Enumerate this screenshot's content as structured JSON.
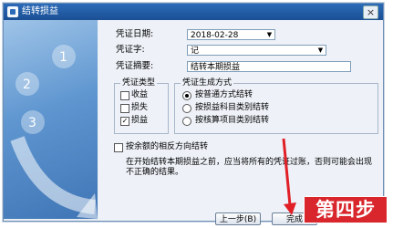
{
  "window": {
    "title": "结转损益",
    "close_glyph": "×"
  },
  "form": {
    "date_label": "凭证日期:",
    "date_value": "2018-02-28",
    "type_label": "凭证字:",
    "type_value": "记",
    "summary_label": "凭证摘要:",
    "summary_value": "结转本期损益"
  },
  "voucher_type_group": {
    "title": "凭证类型",
    "items": [
      {
        "label": "收益",
        "checked": false
      },
      {
        "label": "损失",
        "checked": false
      },
      {
        "label": "损益",
        "checked": true
      }
    ]
  },
  "generation_group": {
    "title": "凭证生成方式",
    "options": [
      {
        "label": "按普通方式结转",
        "selected": true
      },
      {
        "label": "按损益科目类别结转",
        "selected": false
      },
      {
        "label": "按核算项目类别结转",
        "selected": false
      }
    ]
  },
  "reverse_option": {
    "label": "按余额的相反方向结转",
    "checked": false
  },
  "note": "在开始结转本期损益之前，应当将所有的凭证过账，否则可能会出现不正确的结果。",
  "buttons": {
    "prev": "上一步(B)",
    "finish": "完成"
  },
  "overlay": {
    "step_label": "第四步"
  },
  "colors": {
    "title_bar": "#1b4f94",
    "overlay": "#d8262c",
    "arrow": "#e11f26"
  },
  "art_numbers": [
    "1",
    "2",
    "3"
  ]
}
